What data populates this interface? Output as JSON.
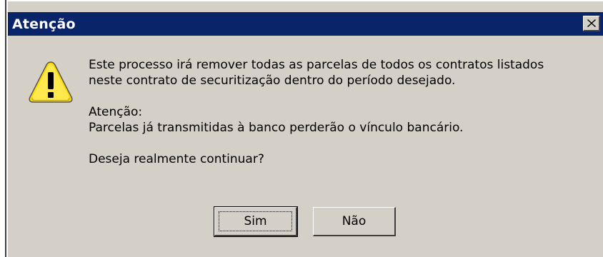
{
  "dialog": {
    "title": "Atenção",
    "close_glyph": "✕",
    "icon": "warning-icon",
    "message_lines": [
      "Este processo irá remover todas as parcelas de todos os contratos listados",
      "neste contrato de securitização dentro do período desejado."
    ],
    "attention_label": "Atenção:",
    "attention_text": "Parcelas já transmitidas à banco perderão o vínculo bancário.",
    "question": "Deseja realmente continuar?",
    "buttons": {
      "yes": "Sim",
      "no": "Não"
    },
    "colors": {
      "titlebar": "#0a246a",
      "face": "#d4d0c8",
      "icon_fill": "#ffd700"
    }
  }
}
